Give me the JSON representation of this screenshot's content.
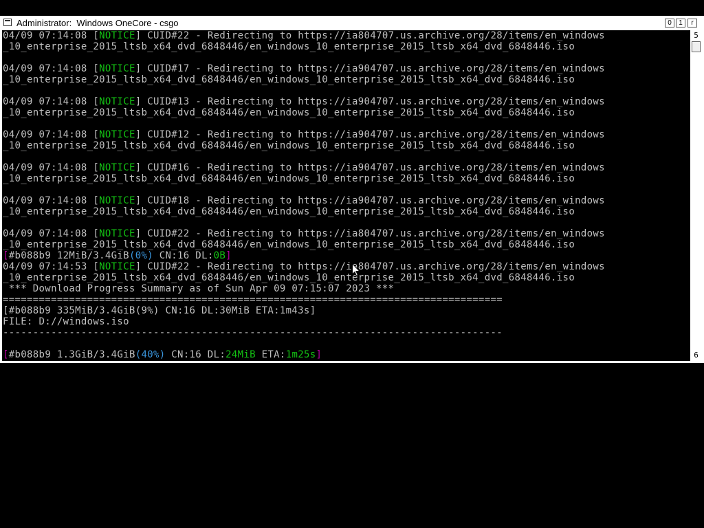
{
  "window": {
    "title": "Administrator:  Windows OneCore - csgo",
    "controls": {
      "minimize": "0",
      "maximize": "1",
      "close": "r"
    }
  },
  "scrollbar": {
    "up_glyph": "5",
    "down_glyph": "6"
  },
  "console": {
    "log_entries": [
      {
        "timestamp": "04/09 07:14:08",
        "level": "NOTICE",
        "message": " CUID#22 - Redirecting to https://ia804707.us.archive.org/28/items/en_windows",
        "wrap": "_10_enterprise_2015_ltsb_x64_dvd_6848446/en_windows_10_enterprise_2015_ltsb_x64_dvd_6848446.iso"
      },
      {
        "timestamp": "04/09 07:14:08",
        "level": "NOTICE",
        "message": " CUID#17 - Redirecting to https://ia904707.us.archive.org/28/items/en_windows",
        "wrap": "_10_enterprise_2015_ltsb_x64_dvd_6848446/en_windows_10_enterprise_2015_ltsb_x64_dvd_6848446.iso"
      },
      {
        "timestamp": "04/09 07:14:08",
        "level": "NOTICE",
        "message": " CUID#13 - Redirecting to https://ia904707.us.archive.org/28/items/en_windows",
        "wrap": "_10_enterprise_2015_ltsb_x64_dvd_6848446/en_windows_10_enterprise_2015_ltsb_x64_dvd_6848446.iso"
      },
      {
        "timestamp": "04/09 07:14:08",
        "level": "NOTICE",
        "message": " CUID#12 - Redirecting to https://ia904707.us.archive.org/28/items/en_windows",
        "wrap": "_10_enterprise_2015_ltsb_x64_dvd_6848446/en_windows_10_enterprise_2015_ltsb_x64_dvd_6848446.iso"
      },
      {
        "timestamp": "04/09 07:14:08",
        "level": "NOTICE",
        "message": " CUID#16 - Redirecting to https://ia904707.us.archive.org/28/items/en_windows",
        "wrap": "_10_enterprise_2015_ltsb_x64_dvd_6848446/en_windows_10_enterprise_2015_ltsb_x64_dvd_6848446.iso"
      },
      {
        "timestamp": "04/09 07:14:08",
        "level": "NOTICE",
        "message": " CUID#18 - Redirecting to https://ia904707.us.archive.org/28/items/en_windows",
        "wrap": "_10_enterprise_2015_ltsb_x64_dvd_6848446/en_windows_10_enterprise_2015_ltsb_x64_dvd_6848446.iso"
      },
      {
        "timestamp": "04/09 07:14:08",
        "level": "NOTICE",
        "message": " CUID#22 - Redirecting to https://ia804707.us.archive.org/28/items/en_windows",
        "wrap": "_10_enterprise_2015_ltsb_x64_dvd_6848446/en_windows_10_enterprise_2015_ltsb_x64_dvd_6848446.iso"
      }
    ],
    "progress_line_1": {
      "open": "[",
      "body": "#b088b9 12MiB/3.4GiB",
      "pct": "(0%)",
      "mid": " CN:16 DL:",
      "dl": "0B",
      "close": "]"
    },
    "last_entry": {
      "timestamp": "04/09 07:14:53",
      "level": "NOTICE",
      "message": " CUID#22 - Redirecting to https://ia804707.us.archive.org/28/items/en_windows",
      "wrap": "_10_enterprise_2015_ltsb_x64_dvd_6848446/en_windows_10_enterprise_2015_ltsb_x64_dvd_6848446.iso"
    },
    "summary_header": " *** Download Progress Summary as of Sun Apr 09 07:15:07 2023 ***",
    "separator_double": "===================================================================================",
    "summary_progress": "[#b088b9 335MiB/3.4GiB(9%) CN:16 DL:30MiB ETA:1m43s]",
    "file_line": "FILE: D://windows.iso",
    "separator_single": "-----------------------------------------------------------------------------------",
    "progress_line_2": {
      "open": "[",
      "body": "#b088b9 1.3GiB/3.4GiB",
      "pct": "(40%)",
      "mid": " CN:16 DL:",
      "dl": "24MiB",
      "eta_label": " ETA:",
      "eta": "1m25s",
      "close": "]"
    }
  },
  "colors": {
    "notice": "#13c313",
    "bracket": "#b4009e",
    "percent": "#3a96dd",
    "console_bg": "#000000",
    "console_fg": "#c0c0c0"
  },
  "icons": {
    "app": "console-window-icon",
    "cursor": "mouse-pointer-icon"
  }
}
